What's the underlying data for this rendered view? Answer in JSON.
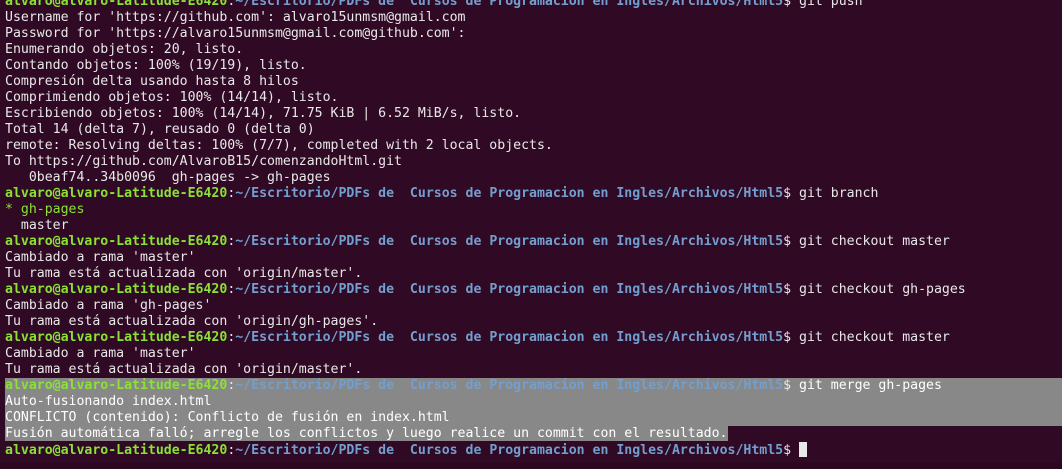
{
  "prompt": {
    "user_host": "alvaro@alvaro-Latitude-E6420",
    "colon": ":",
    "path": "~/Escritorio/PDFs de  Cursos de Programacion en Ingles/Archivos/Html5",
    "symbol": "$ "
  },
  "lines": [
    {
      "type": "prompt",
      "cmd": "git push"
    },
    {
      "type": "out",
      "text": "Username for 'https://github.com': alvaro15unmsm@gmail.com"
    },
    {
      "type": "out",
      "text": "Password for 'https://alvaro15unmsm@gmail.com@github.com':"
    },
    {
      "type": "out",
      "text": "Enumerando objetos: 20, listo."
    },
    {
      "type": "out",
      "text": "Contando objetos: 100% (19/19), listo."
    },
    {
      "type": "out",
      "text": "Compresión delta usando hasta 8 hilos"
    },
    {
      "type": "out",
      "text": "Comprimiendo objetos: 100% (14/14), listo."
    },
    {
      "type": "out",
      "text": "Escribiendo objetos: 100% (14/14), 71.75 KiB | 6.52 MiB/s, listo."
    },
    {
      "type": "out",
      "text": "Total 14 (delta 7), reusado 0 (delta 0)"
    },
    {
      "type": "out",
      "text": "remote: Resolving deltas: 100% (7/7), completed with 2 local objects."
    },
    {
      "type": "out",
      "text": "To https://github.com/AlvaroB15/comenzandoHtml.git"
    },
    {
      "type": "out",
      "text": "   0beaf74..34b0096  gh-pages -> gh-pages"
    },
    {
      "type": "prompt",
      "cmd": "git branch"
    },
    {
      "type": "out",
      "text": "* gh-pages",
      "color": "green"
    },
    {
      "type": "out",
      "text": "  master"
    },
    {
      "type": "prompt",
      "cmd": "git checkout master"
    },
    {
      "type": "out",
      "text": "Cambiado a rama 'master'"
    },
    {
      "type": "out",
      "text": "Tu rama está actualizada con 'origin/master'."
    },
    {
      "type": "prompt",
      "cmd": "git checkout gh-pages"
    },
    {
      "type": "out",
      "text": "Cambiado a rama 'gh-pages'"
    },
    {
      "type": "out",
      "text": "Tu rama está actualizada con 'origin/gh-pages'."
    },
    {
      "type": "prompt",
      "cmd": "git checkout master"
    },
    {
      "type": "out",
      "text": "Cambiado a rama 'master'"
    },
    {
      "type": "out",
      "text": "Tu rama está actualizada con 'origin/master'."
    },
    {
      "type": "prompt",
      "cmd": "git merge gh-pages",
      "selected": "full"
    },
    {
      "type": "out",
      "text": "Auto-fusionando index.html",
      "selected": "full"
    },
    {
      "type": "out",
      "text": "CONFLICTO (contenido): Conflicto de fusión en index.html",
      "selected": "full"
    },
    {
      "type": "out",
      "text": "Fusión automática falló; arregle los conflictos y luego realice un commit con el resultado.",
      "selected": "partial"
    },
    {
      "type": "prompt",
      "cmd": "",
      "cursor": true
    }
  ],
  "colors": {
    "background": "#300a24",
    "user_host": "#8ae234",
    "path": "#729fcf",
    "text": "#e8e8e8",
    "selection": "#888888"
  }
}
